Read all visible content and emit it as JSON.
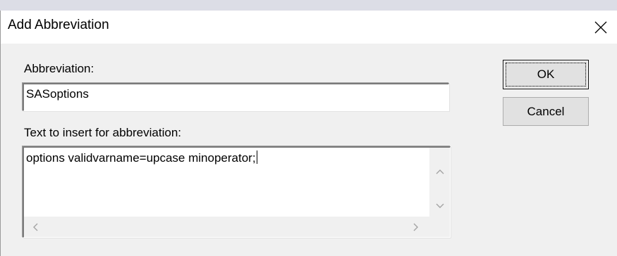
{
  "dialog": {
    "title": "Add Abbreviation",
    "close_icon": "close-icon"
  },
  "abbreviation": {
    "label": "Abbreviation:",
    "value": "SASoptions"
  },
  "insert_text": {
    "label": "Text to insert for abbreviation:",
    "value": "options validvarname=upcase minoperator;"
  },
  "buttons": {
    "ok": "OK",
    "cancel": "Cancel"
  },
  "scrollbars": {
    "up_icon": "chevron-up-icon",
    "down_icon": "chevron-down-icon",
    "left_icon": "chevron-left-icon",
    "right_icon": "chevron-right-icon"
  }
}
